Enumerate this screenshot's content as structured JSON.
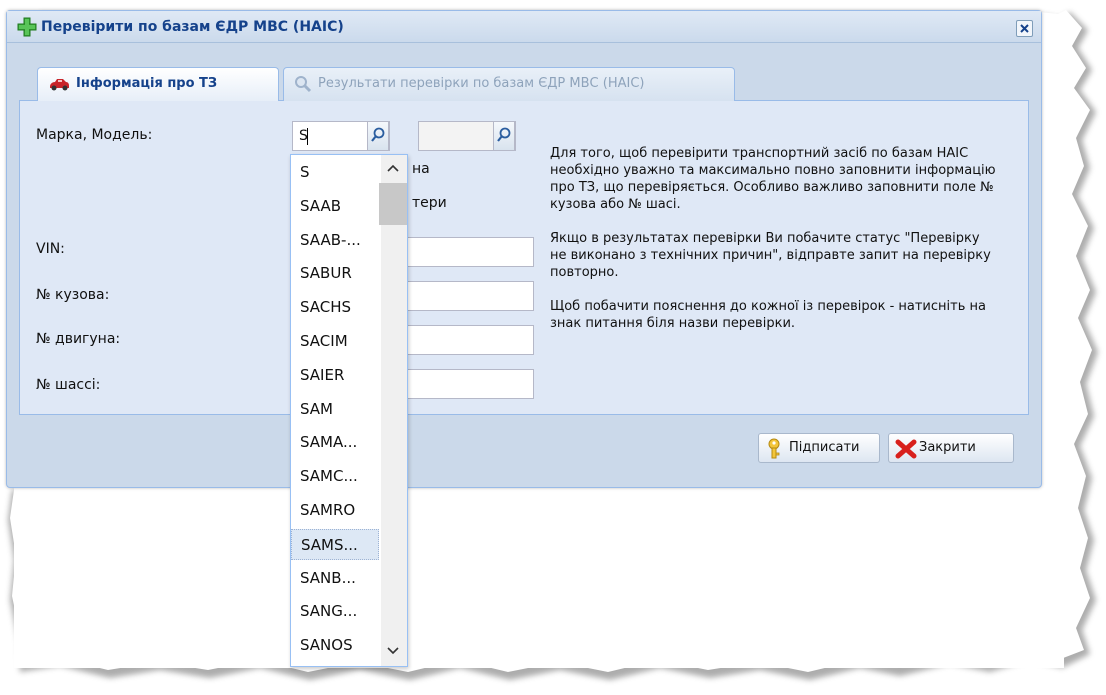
{
  "window": {
    "title": "Перевірити по базам ЄДР МВС (НАІС)"
  },
  "tabs": [
    {
      "label": "Інформація про ТЗ",
      "active": true,
      "icon": "car-icon"
    },
    {
      "label": "Результати перевірки по базам ЄДР МВС (НАІС)",
      "active": false,
      "icon": "search-icon"
    }
  ],
  "form": {
    "make_model_label": "Марка, Модель:",
    "make_value": "S",
    "model_value": "",
    "checkbox_text_line1": "на",
    "checkbox_text_line2": "тери",
    "vin_label": "VIN:",
    "body_label": "№ кузова:",
    "engine_label": "№ двигуна:",
    "chassis_label": "№ шассі:"
  },
  "help": {
    "p1": "Для того, щоб перевірити транспортний засіб по базам НАІС необхідно уважно та максимально повно заповнити інформацію про ТЗ, що перевіряється. Особливо важливо заповнити поле № кузова або № шасі.",
    "p2": "Якщо в результатах перевірки Ви побачите статус \"Перевірку не виконано з технічних причин\", відправте запит на перевірку повторно.",
    "p3": "Щоб побачити пояснення до кожної із перевірок - натисніть на знак питання біля назви перевірки."
  },
  "buttons": {
    "sign": "Підписати",
    "close": "Закрити"
  },
  "dropdown": {
    "items": [
      "S",
      "SAAB",
      "SAAB-...",
      "SABUR",
      "SACHS",
      "SACIM",
      "SAIER",
      "SAM",
      "SAMA...",
      "SAMC...",
      "SAMRO",
      "SAMS...",
      "SANB...",
      "SANG...",
      "SANOS"
    ],
    "selected_index": 11
  }
}
